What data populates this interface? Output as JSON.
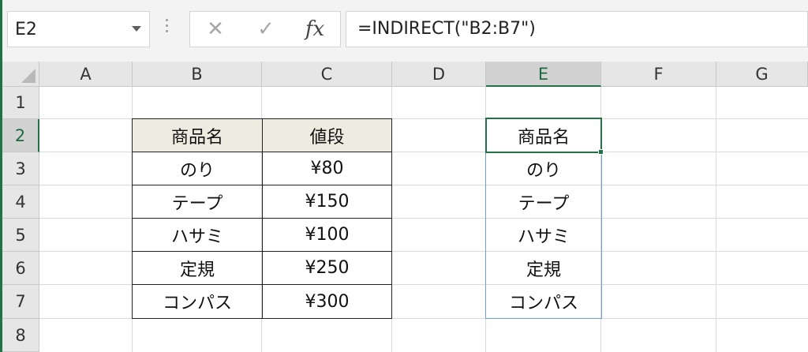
{
  "formula_bar": {
    "name_box": "E2",
    "cancel_icon": "close-icon",
    "enter_icon": "check-icon",
    "fx_label": "fx",
    "formula": "=INDIRECT(\"B2:B7\")"
  },
  "columns": [
    "A",
    "B",
    "C",
    "D",
    "E",
    "F",
    "G"
  ],
  "selected_column": "E",
  "rows": [
    "1",
    "2",
    "3",
    "4",
    "5",
    "6",
    "7",
    "8"
  ],
  "selected_row": "2",
  "table": {
    "headers": [
      "商品名",
      "値段"
    ],
    "rows": [
      [
        "のり",
        "¥80"
      ],
      [
        "テープ",
        "¥150"
      ],
      [
        "ハサミ",
        "¥100"
      ],
      [
        "定規",
        "¥250"
      ],
      [
        "コンパス",
        "¥300"
      ]
    ]
  },
  "spill": [
    "商品名",
    "のり",
    "テープ",
    "ハサミ",
    "定規",
    "コンパス"
  ],
  "colors": {
    "accent": "#217346",
    "table_header_fill": "#eeebe0",
    "spill_border": "#6d9dd8"
  }
}
